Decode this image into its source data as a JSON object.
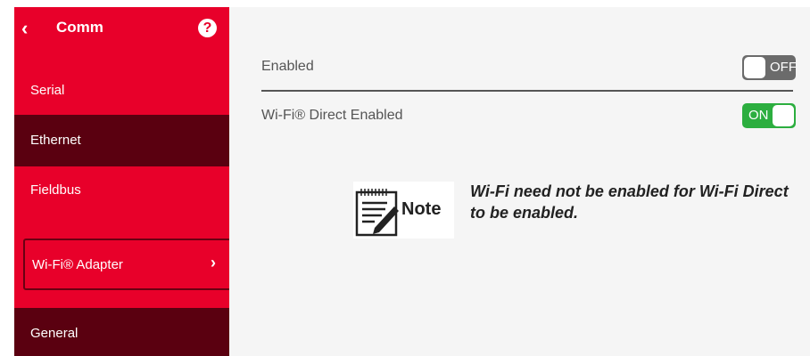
{
  "sidebar": {
    "title": "Comm",
    "back_icon": "chevron-left-icon",
    "help_icon": "question-circle-icon",
    "help_glyph": "?",
    "items": [
      {
        "label": "Serial",
        "active": false
      },
      {
        "label": "Ethernet",
        "active": true
      },
      {
        "label": "Fieldbus",
        "active": false
      },
      {
        "label": "Wi-Fi® Adapter",
        "active": false,
        "expandable": true
      },
      {
        "label": "General",
        "active": true
      }
    ],
    "colors": {
      "background": "#e8002a",
      "active": "#5a0010"
    }
  },
  "settings": {
    "enabled": {
      "label": "Enabled",
      "state": "OFF",
      "value": false
    },
    "wifi_direct": {
      "label": "Wi-Fi® Direct Enabled",
      "state": "ON",
      "value": true
    },
    "colors": {
      "off": "#6b6b6b",
      "on": "#2cae3f"
    }
  },
  "note": {
    "label": "Note",
    "icon": "notepad-pencil-icon",
    "text": "Wi-Fi need not be enabled for Wi-Fi Direct to be enabled."
  }
}
